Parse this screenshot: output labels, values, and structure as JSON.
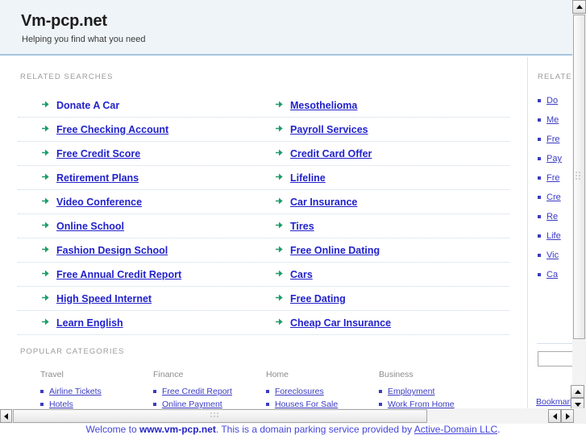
{
  "header": {
    "title": "Vm-pcp.net",
    "tagline": "Helping you find what you need"
  },
  "main": {
    "related_label": "RELATED SEARCHES",
    "bullet_icon": "green-arrow-bullet",
    "links_left": [
      "Donate A Car",
      "Free Checking Account",
      "Free Credit Score",
      "Retirement Plans",
      "Video Conference",
      "Online School",
      "Fashion Design School",
      "Free Annual Credit Report",
      "High Speed Internet",
      "Learn English"
    ],
    "links_right": [
      "Mesothelioma",
      "Payroll Services",
      "Credit Card Offer",
      "Lifeline",
      "Car Insurance",
      "Tires",
      "Free Online Dating",
      "Cars",
      "Free Dating",
      "Cheap Car Insurance"
    ]
  },
  "sidebar": {
    "related_label": "RELATED",
    "bullet_icon": "square-dot-bullet",
    "links": [
      "Do",
      "Me",
      "Fre",
      "Pay",
      "Fre",
      "Cre",
      "Re",
      "Life",
      "Vic",
      "Ca"
    ],
    "search_value": "",
    "search_placeholder": "",
    "bookmark_label": "Bookmark"
  },
  "categories": {
    "label": "POPULAR CATEGORIES",
    "columns": [
      {
        "head": "Travel",
        "items": [
          "Airline Tickets",
          "Hotels"
        ]
      },
      {
        "head": "Finance",
        "items": [
          "Free Credit Report",
          "Online Payment"
        ]
      },
      {
        "head": "Home",
        "items": [
          "Foreclosures",
          "Houses For Sale"
        ]
      },
      {
        "head": "Business",
        "items": [
          "Employment",
          "Work From Home"
        ]
      }
    ]
  },
  "footer": {
    "prefix": "Welcome to ",
    "domain": "www.vm-pcp.net",
    "middle": ". This is a domain parking service provided by ",
    "provider": "Active-Domain LLC",
    "suffix": "."
  },
  "colors": {
    "header_bg": "#eef4f8",
    "header_rule": "#a8c4dd",
    "link": "#2222cc",
    "bullet_green": "#1f9d6b",
    "label_gray": "#9a9a9a",
    "footer_text": "#4444dd"
  }
}
